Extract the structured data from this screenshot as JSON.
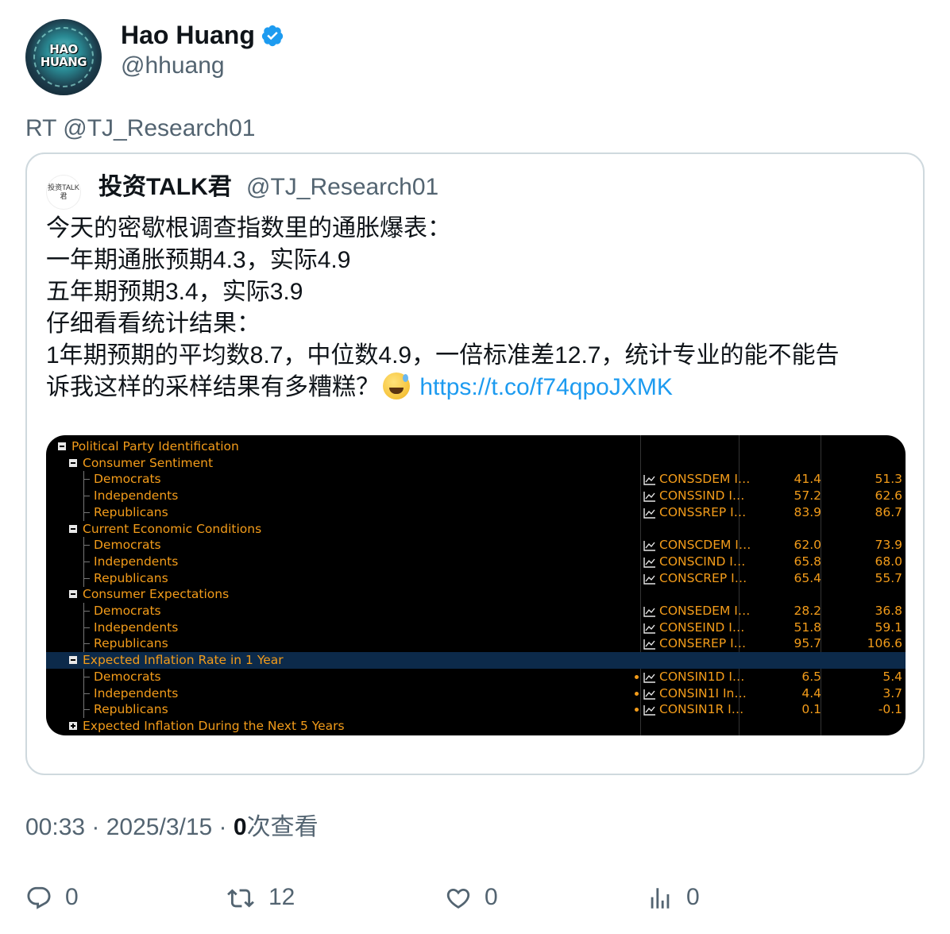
{
  "author": {
    "avatar_text": "HAO HUANG",
    "name": "Hao Huang",
    "handle": "@hhuang"
  },
  "retweet": {
    "label": "RT @TJ_Research01"
  },
  "quoted": {
    "avatar_text": "投资TALK君",
    "name": "投资TALK君",
    "handle": "@TJ_Research01",
    "lines": [
      "今天的密歇根调查指数里的通胀爆表：",
      "一年期通胀预期4.3，实际4.9",
      "五年期预期3.4，实际3.9",
      "仔细看看统计结果：",
      "1年期预期的平均数8.7，中位数4.9，一倍标准差12.7，统计专业的能不能告",
      "诉我这样的采样结果有多糟糕？"
    ],
    "link": "https://t.co/f74qpoJXMK",
    "terminal": {
      "rows": [
        {
          "label": "Political Party Identification",
          "level": 0,
          "box": "minus",
          "code": "",
          "v1": "",
          "v2": ""
        },
        {
          "label": "Consumer Sentiment",
          "level": 1,
          "box": "minus",
          "code": "",
          "v1": "",
          "v2": ""
        },
        {
          "label": "Democrats",
          "level": 2,
          "box": "",
          "code": "CONSSDEM I…",
          "v1": "41.4",
          "v2": "51.3"
        },
        {
          "label": "Independents",
          "level": 2,
          "box": "",
          "code": "CONSSIND I…",
          "v1": "57.2",
          "v2": "62.6"
        },
        {
          "label": "Republicans",
          "level": 2,
          "box": "",
          "code": "CONSSREP I…",
          "v1": "83.9",
          "v2": "86.7"
        },
        {
          "label": "Current Economic Conditions",
          "level": 1,
          "box": "minus",
          "code": "",
          "v1": "",
          "v2": ""
        },
        {
          "label": "Democrats",
          "level": 2,
          "box": "",
          "code": "CONSCDEM I…",
          "v1": "62.0",
          "v2": "73.9"
        },
        {
          "label": "Independents",
          "level": 2,
          "box": "",
          "code": "CONSCIND I…",
          "v1": "65.8",
          "v2": "68.0"
        },
        {
          "label": "Republicans",
          "level": 2,
          "box": "",
          "code": "CONSCREP I…",
          "v1": "65.4",
          "v2": "55.7"
        },
        {
          "label": "Consumer Expectations",
          "level": 1,
          "box": "minus",
          "code": "",
          "v1": "",
          "v2": ""
        },
        {
          "label": "Democrats",
          "level": 2,
          "box": "",
          "code": "CONSEDEM I…",
          "v1": "28.2",
          "v2": "36.8"
        },
        {
          "label": "Independents",
          "level": 2,
          "box": "",
          "code": "CONSEIND I…",
          "v1": "51.8",
          "v2": "59.1"
        },
        {
          "label": "Republicans",
          "level": 2,
          "box": "",
          "code": "CONSEREP I…",
          "v1": "95.7",
          "v2": "106.6"
        },
        {
          "label": "Expected Inflation Rate in 1 Year",
          "level": 1,
          "box": "minus",
          "code": "",
          "v1": "",
          "v2": "",
          "selected": true
        },
        {
          "label": "Democrats",
          "level": 2,
          "box": "",
          "code": "CONSIN1D I…",
          "v1": "6.5",
          "v2": "5.4",
          "dot": true
        },
        {
          "label": "Independents",
          "level": 2,
          "box": "",
          "code": "CONSIN1I In…",
          "v1": "4.4",
          "v2": "3.7",
          "dot": true
        },
        {
          "label": "Republicans",
          "level": 2,
          "box": "",
          "code": "CONSIN1R I…",
          "v1": "0.1",
          "v2": "-0.1",
          "dot": true
        },
        {
          "label": "Expected Inflation During the Next 5 Years",
          "level": 1,
          "box": "plus",
          "code": "",
          "v1": "",
          "v2": ""
        }
      ]
    }
  },
  "meta": {
    "time": "00:33",
    "sep": " · ",
    "date": "2025/3/15",
    "views_count": "0",
    "views_label": "次查看"
  },
  "actions": {
    "reply_count": "0",
    "retweet_count": "12",
    "like_count": "0",
    "views_count": "0"
  },
  "colors": {
    "verified": "#1d9bf0",
    "link": "#1d9bf0",
    "terminal_text": "#f39c1a",
    "terminal_bg": "#000000",
    "selected_row": "#0c2a4a"
  }
}
